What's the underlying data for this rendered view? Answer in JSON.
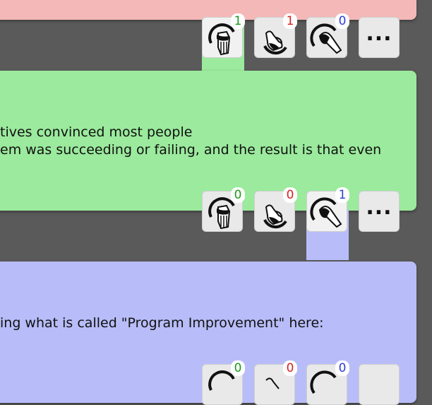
{
  "cards": [
    {
      "color": "#f5b8b8",
      "reactions": [
        {
          "name": "thumbs-up",
          "count": "1",
          "count_color": "#1a9b1a",
          "selected": true
        },
        {
          "name": "ok",
          "count": "1",
          "count_color": "#d62020",
          "selected": false
        },
        {
          "name": "point",
          "count": "0",
          "count_color": "#2b3fd6",
          "selected": false
        }
      ],
      "more_label": "..."
    },
    {
      "color": "#9bea9d",
      "lines": [
        "tives convinced most people",
        "em was succeeding or failing, and the result is that even"
      ],
      "reactions": [
        {
          "name": "thumbs-up",
          "count": "0",
          "count_color": "#1a9b1a",
          "selected": false
        },
        {
          "name": "ok",
          "count": "0",
          "count_color": "#d62020",
          "selected": false
        },
        {
          "name": "point",
          "count": "1",
          "count_color": "#2b3fd6",
          "selected": true
        }
      ],
      "more_label": "..."
    },
    {
      "color": "#b8bdf9",
      "lines": [
        "ing what is called \"Program Improvement\" here:"
      ],
      "reactions": [
        {
          "name": "thumbs-up",
          "count": "0",
          "count_color": "#1a9b1a",
          "selected": false
        },
        {
          "name": "ok",
          "count": "0",
          "count_color": "#d62020",
          "selected": false
        },
        {
          "name": "point",
          "count": "0",
          "count_color": "#2b3fd6",
          "selected": false
        }
      ],
      "more_label": ""
    }
  ]
}
